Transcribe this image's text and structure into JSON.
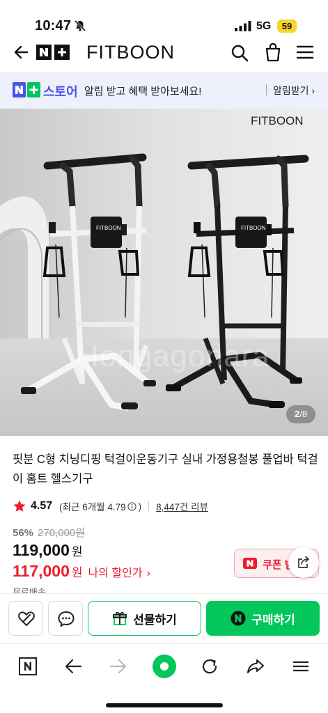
{
  "status_bar": {
    "time": "10:47",
    "network": "5G",
    "battery": "59"
  },
  "header": {
    "brand": "FITBOON"
  },
  "banner": {
    "store_name": "스토어",
    "message": "알림 받고 혜택 받아보세요!",
    "action": "알림받기 ›"
  },
  "gallery": {
    "current": "2",
    "separator": "/",
    "total": "8",
    "brand_mark": "FITBOON",
    "watermark": "Hongagonara",
    "device_label": "FITBOON"
  },
  "product": {
    "title": "핏분 C형 치닝디핑 턱걸이운동기구 실내 가정용철봉 풀업바 턱걸이 홈트 헬스기구",
    "rating": "4.57",
    "recent_rating_prefix": "(최근 6개월 4.79",
    "recent_rating_suffix": ")",
    "review_count": "8,447건 리뷰",
    "discount_rate": "56%",
    "original_price": "270,000원",
    "price": "119,000",
    "price_unit": "원",
    "sale_price": "117,000",
    "sale_unit": "원",
    "sale_label": "나의 할인가",
    "sale_chevron": "›",
    "coupon_label": "쿠폰 받기",
    "delivery_peek": "무료배송"
  },
  "actions": {
    "gift": "선물하기",
    "buy": "구매하기"
  },
  "colors": {
    "naver_green": "#03c75a",
    "sale_red": "#ee1c2a",
    "store_blue": "#4c53e8",
    "battery_yellow": "#f7d52c"
  },
  "icons": {
    "back": "back-arrow-icon",
    "search": "search-icon",
    "cart": "cart-icon",
    "menu": "menu-icon",
    "wish": "heart-icon",
    "talk": "talk-bubble-icon",
    "gift": "gift-icon",
    "share": "share-icon",
    "toolbar": [
      "naver-n-icon",
      "back-icon",
      "forward-icon",
      "home-dot-icon",
      "refresh-icon",
      "share-arrow-icon",
      "menu-icon"
    ]
  }
}
